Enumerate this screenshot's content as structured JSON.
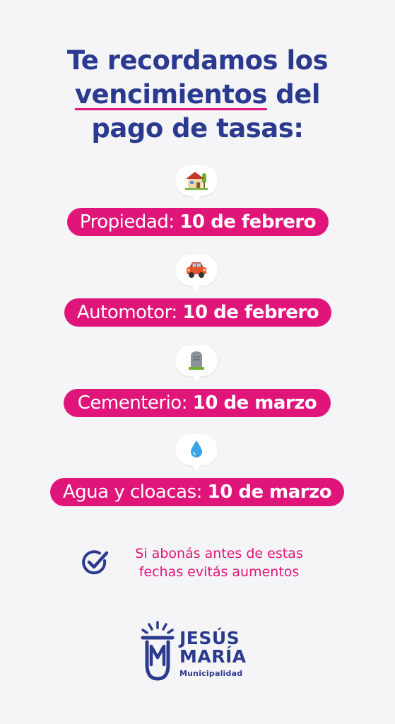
{
  "header": {
    "line1": "Te recordamos los",
    "line2_underlined": "vencimientos",
    "line2_rest": " del",
    "line3": "pago de tasas:"
  },
  "items": [
    {
      "icon": "house-icon",
      "label": "Propiedad:",
      "date": "10 de febrero"
    },
    {
      "icon": "car-icon",
      "label": "Automotor:",
      "date": "10 de febrero"
    },
    {
      "icon": "tombstone-icon",
      "label": "Cementerio:",
      "date": "10 de marzo"
    },
    {
      "icon": "water-drop-icon",
      "label": "Agua y cloacas:",
      "date": "10 de marzo"
    }
  ],
  "note": {
    "icon": "check-circle-icon",
    "line1": "Si abonás antes de estas",
    "line2": "fechas evitás aumentos"
  },
  "logo": {
    "line1": "JESÚS",
    "line2": "MARÍA",
    "subtitle": "Municipalidad"
  },
  "colors": {
    "primary_blue": "#2b3a8f",
    "accent_pink": "#e0157a",
    "background": "#f5f5f7"
  }
}
